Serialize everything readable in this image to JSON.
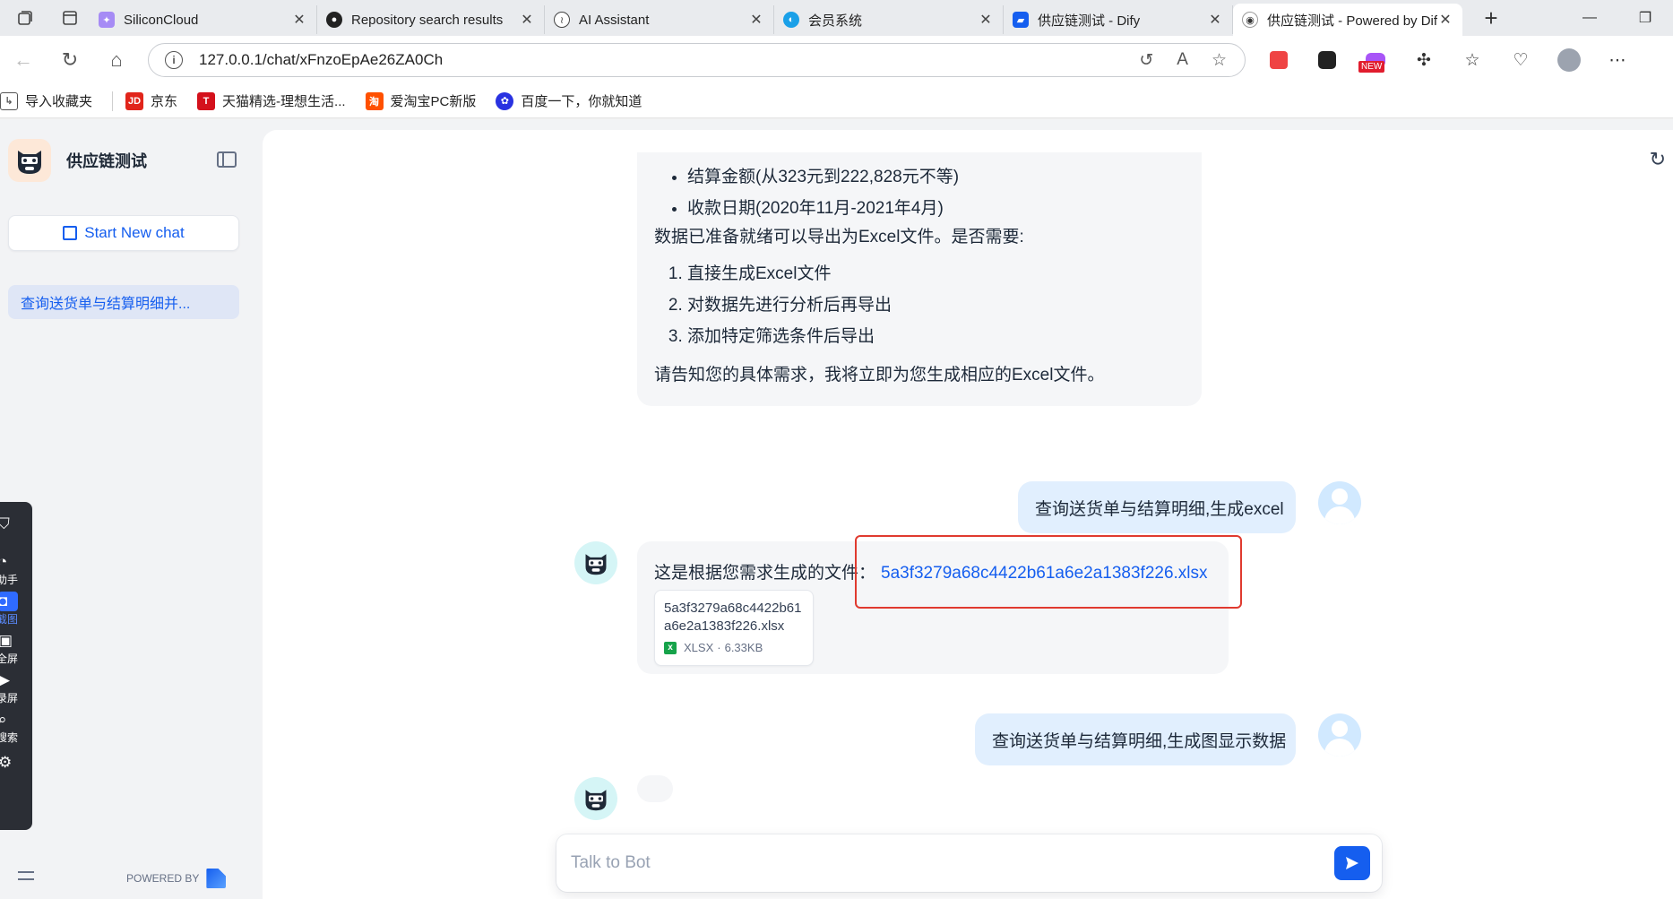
{
  "browser": {
    "tabs": [
      {
        "title": "SiliconCloud",
        "icon": "siliconcloud-icon",
        "color": "#a68bf5"
      },
      {
        "title": "Repository search results",
        "icon": "github-icon",
        "color": "#222222"
      },
      {
        "title": "AI Assistant",
        "icon": "audio-wave-icon",
        "color": "#444444"
      },
      {
        "title": "会员系统",
        "icon": "member-system-icon",
        "color": "#1aa0e8"
      },
      {
        "title": "供应链测试 - Dify",
        "icon": "dify-icon",
        "color": "#155eef"
      },
      {
        "title": "供应链测试 - Powered by Dify",
        "icon": "bot-icon",
        "color": "#333333",
        "active": true
      }
    ],
    "new_tab_label": "+",
    "url": "127.0.0.1/chat/xFnzoEpAe26ZA0Ch",
    "bookmarks": [
      {
        "label": "导入收藏夹",
        "icon": "import-icon",
        "color": "#555555"
      },
      {
        "label": "京东",
        "icon": "jd-icon",
        "color": "#e1251b"
      },
      {
        "label": "天猫精选-理想生活...",
        "icon": "tmall-icon",
        "color": "#d4111c"
      },
      {
        "label": "爱淘宝PC新版",
        "icon": "taobao-icon",
        "color": "#ff5000"
      },
      {
        "label": "百度一下，你就知道",
        "icon": "baidu-icon",
        "color": "#2932e1"
      }
    ],
    "extensions": {
      "new_badge": "NEW"
    }
  },
  "sidebar": {
    "app_name": "供应链测试",
    "new_chat_label": "Start New chat",
    "conversations": [
      {
        "title": "查询送货单与结算明细并..."
      }
    ],
    "powered_by": "POWERED BY"
  },
  "float_widget": {
    "items": [
      {
        "label": "",
        "icon": "shield-icon"
      },
      {
        "label": "助手",
        "icon": "assistant-icon"
      },
      {
        "label": "截图",
        "icon": "camera-icon",
        "active": true
      },
      {
        "label": "全屏",
        "icon": "monitor-icon"
      },
      {
        "label": "录屏",
        "icon": "video-icon"
      },
      {
        "label": "搜索",
        "icon": "search-icon"
      },
      {
        "label": "",
        "icon": "gear-icon"
      }
    ]
  },
  "chat": {
    "messages": {
      "bot1": {
        "bullets": [
          "结算金额(从323元到222,828元不等)",
          "收款日期(2020年11月-2021年4月)"
        ],
        "intro": "数据已准备就绪可以导出为Excel文件。是否需要:",
        "options": [
          "直接生成Excel文件",
          "对数据先进行分析后再导出",
          "添加特定筛选条件后导出"
        ],
        "outro": "请告知您的具体需求，我将立即为您生成相应的Excel文件。"
      },
      "user1": "查询送货单与结算明细,生成excel",
      "bot2": {
        "text": "这是根据您需求生成的文件：",
        "link": "5a3f3279a68c4422b61a6e2a1383f226.xlsx",
        "file": {
          "name": "5a3f3279a68c4422b61a6e2a1383f226.xlsx",
          "type": "XLSX",
          "size": "6.33KB"
        }
      },
      "user2": "查询送货单与结算明细,生成图显示数据"
    },
    "input_placeholder": "Talk to Bot"
  },
  "colors": {
    "accent": "#155eef",
    "highlight_box": "#e03a2f",
    "user_bubble": "#e1effe",
    "bot_bubble": "#f5f6f8"
  }
}
